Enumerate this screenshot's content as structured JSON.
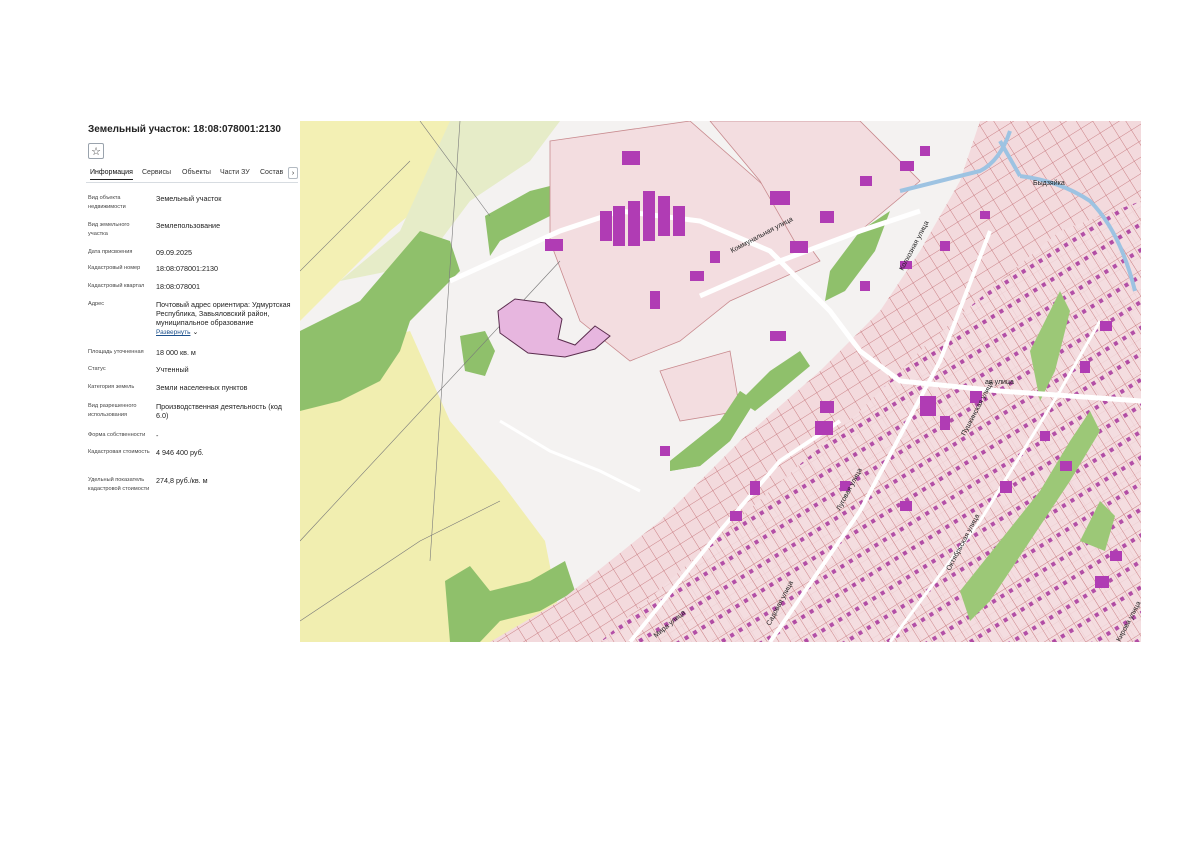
{
  "panel": {
    "title": "Земельный участок: 18:08:078001:2130",
    "favorite_icon": "star-icon",
    "tabs": [
      {
        "label": "Информация",
        "active": true
      },
      {
        "label": "Сервисы"
      },
      {
        "label": "Объекты"
      },
      {
        "label": "Части ЗУ"
      },
      {
        "label": "Состав"
      }
    ],
    "tabs_next_icon": "chevron-right-icon",
    "fields": [
      {
        "label": "Вид объекта недвижимости",
        "value": "Земельный участок"
      },
      {
        "label": "Вид земельного участка",
        "value": "Землепользование"
      },
      {
        "label": "Дата присвоения",
        "value": "09.09.2025"
      },
      {
        "label": "Кадастровый номер",
        "value": "18:08:078001:2130"
      },
      {
        "label": "Кадастровый квартал",
        "value": "18:08:078001"
      },
      {
        "label": "Адрес",
        "value": "Почтовый адрес ориентира: Удмуртская Республика, Завьяловский район, муниципальное образование",
        "link": "Развернуть"
      },
      {
        "label": "Площадь уточненная",
        "value": "18 000 кв. м"
      },
      {
        "label": "Статус",
        "value": "Учтенный"
      },
      {
        "label": "Категория земель",
        "value": "Земли населенных пунктов"
      },
      {
        "label": "Вид разрешенного использования",
        "value": "Производственная деятельность (код 6.0)"
      },
      {
        "label": "Форма собственности",
        "value": "-"
      },
      {
        "label": "Кадастровая стоимость",
        "value": "4 946 400 руб."
      },
      {
        "label": "Удельный показатель кадастровой стоимости",
        "value": "274,8 руб./кв. м"
      }
    ]
  },
  "map": {
    "street_labels": [
      "Коммунальная улица",
      "Колхозная улица",
      "ая улица",
      "Луговая улица",
      "Пушкинская улица",
      "Садовая улица",
      "Октябрьская улица",
      "Быдзяйка",
      "Мира улица",
      "Кирова улица"
    ],
    "colors": {
      "residential": "#f4dde0",
      "forest": "#8fc06b",
      "field": "#f3f0b4",
      "building": "#b03cb4",
      "selected_parcel": "#e7b6df",
      "parcel_border": "#c0686e",
      "water": "#9dc3e2"
    }
  }
}
